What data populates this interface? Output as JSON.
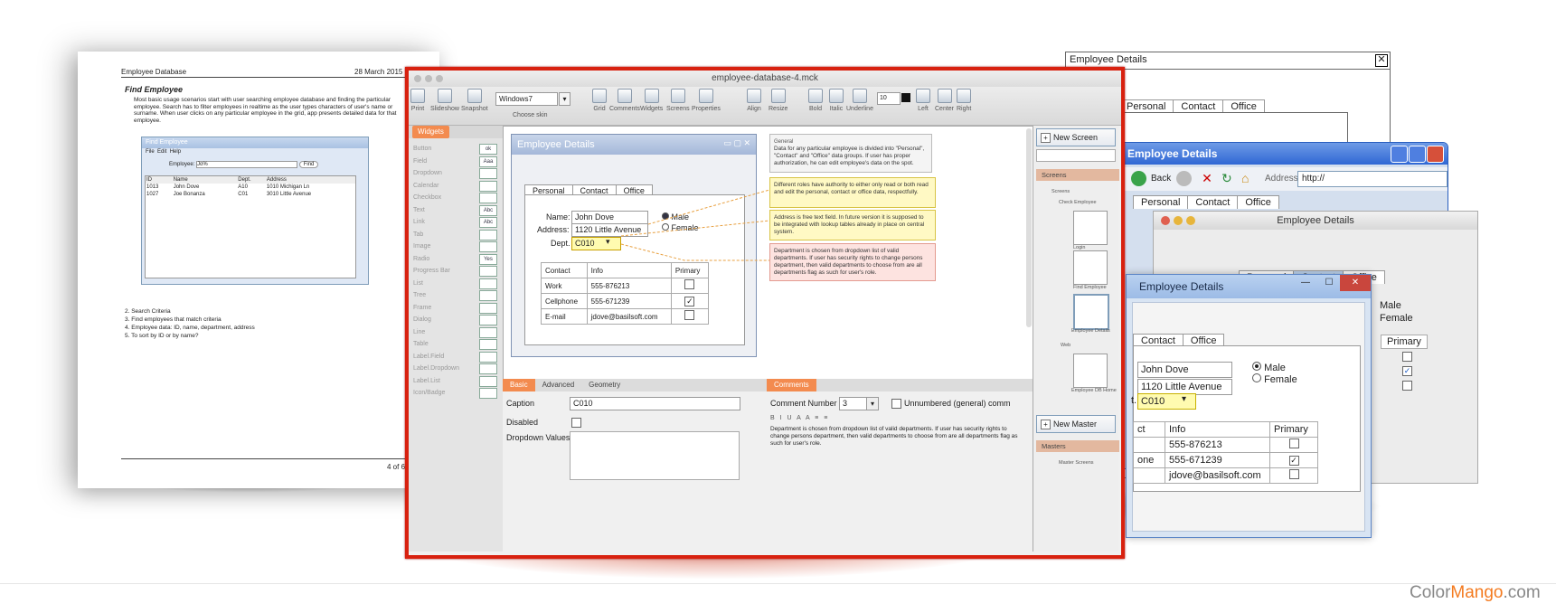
{
  "doc": {
    "header_left": "Employee Database",
    "header_right": "28 March 2015",
    "heading": "Find Employee",
    "para": "Most basic usage scenarios start with user searching employee database and finding the particular employee. Search has to filter employees in realtime as the user types characters of user's name or surname. When user clicks on any particular employee in the grid, app presents detailed data for that employee.",
    "mini_title": "Find Employee",
    "mini_menu": [
      "File",
      "Edit",
      "Help"
    ],
    "mini_label": "Employee:",
    "mini_value": "Jo%",
    "mini_find": "Find",
    "mini_cols": [
      "ID",
      "Name",
      "Dept.",
      "Address"
    ],
    "mini_rows": [
      [
        "1013",
        "John Dove",
        "A10",
        "1010 Michigan Ln"
      ],
      [
        "1027",
        "Joe Bonanza",
        "C01",
        "3010 Little Avenue"
      ]
    ],
    "list": [
      "2.  Search Criteria",
      "3.  Find employees that match criteria",
      "4.  Employee data: ID, name, department, address",
      "5.  To sort by ID or by name?"
    ],
    "footer": "4 of 6"
  },
  "plain": {
    "title": "Employee Details",
    "tabs": [
      "Personal",
      "Contact",
      "Office"
    ]
  },
  "xp": {
    "title": "Employee Details",
    "back": "Back",
    "address_label": "Address",
    "address": "http://",
    "tabs": [
      "Personal",
      "Contact",
      "Office"
    ]
  },
  "mac": {
    "title": "Employee Details",
    "tabs": [
      "Personal",
      "Contact",
      "Office"
    ],
    "male": "Male",
    "female": "Female",
    "primary": "Primary"
  },
  "w7": {
    "title": "Employee Details",
    "tabs": [
      "Contact",
      "Office"
    ],
    "name": "John Dove",
    "address": "1120 Little Avenue",
    "dept": "C010",
    "dept_label": "t.",
    "male": "Male",
    "female": "Female",
    "grid_head": [
      "ct",
      "Info",
      "Primary"
    ],
    "grid_rows": [
      [
        "",
        "555-876213",
        false
      ],
      [
        "one",
        "555-671239",
        true
      ],
      [
        "",
        "jdove@basilsoft.com",
        false
      ]
    ]
  },
  "main": {
    "window_title": "employee-database-4.mck",
    "skin_value": "Windows7",
    "skin_label": "Choose skin",
    "font_size": "10",
    "toolbar": [
      "Print",
      "Slideshow",
      "Snapshot",
      "Grid",
      "Comments",
      "Widgets",
      "Screens",
      "Properties",
      "Align",
      "Resize",
      "Bold",
      "Italic",
      "Underline",
      "Left",
      "Center",
      "Right"
    ],
    "library_tab": "Widgets",
    "library": [
      "Button",
      "Field",
      "Dropdown",
      "Calendar",
      "Checkbox",
      "Text",
      "Link",
      "Tab",
      "Image",
      "Radio",
      "Progress Bar",
      "List",
      "Tree",
      "Frame",
      "Dialog",
      "Line",
      "Table",
      "Label.Field",
      "Label.Dropdown",
      "Label.List",
      "Icon/Badge"
    ],
    "library_previews": [
      "ok",
      "Aaa",
      "",
      "",
      "",
      "Abc",
      "Abc",
      "",
      "",
      "Yes",
      "",
      "",
      "",
      "",
      "",
      "",
      "",
      "",
      "",
      "",
      ""
    ],
    "design": {
      "title": "Employee Details",
      "tabs": [
        "Personal",
        "Contact",
        "Office"
      ],
      "name_label": "Name:",
      "name": "John Dove",
      "address_label": "Address:",
      "address": "1120 Little Avenue",
      "dept_label": "Dept.",
      "dept": "C010",
      "male": "Male",
      "female": "Female",
      "grid_head": [
        "Contact",
        "Info",
        "Primary"
      ],
      "grid_rows": [
        [
          "Work",
          "555-876213",
          false
        ],
        [
          "Cellphone",
          "555-671239",
          true
        ],
        [
          "E-mail",
          "jdove@basilsoft.com",
          false
        ]
      ]
    },
    "notes": [
      {
        "title": "General",
        "text": "Data for any particular employee is divided into \"Personal\", \"Contact\" and \"Office\" data groups. If user has proper authorization, he can edit employee's data on the spot."
      },
      {
        "title": "",
        "text": "Different roles have authority to either only read or both read and edit the personal, contact or office data, respectfully."
      },
      {
        "title": "",
        "text": "Address is free text field. In future version it is supposed to be integrated with lookup tables already in place on central system."
      },
      {
        "title": "",
        "text": "Department is chosen from dropdown list of valid departments. If user has security rights to change persons department, then valid departments to choose from are all departments flag as such for user's role."
      }
    ],
    "props_tabs": [
      "Basic",
      "Advanced",
      "Geometry"
    ],
    "caption_label": "Caption",
    "caption_value": "C010",
    "disabled_label": "Disabled",
    "dropdown_label": "Dropdown Values",
    "comments_tab": "Comments",
    "comment_number_label": "Comment Number",
    "comment_number": "3",
    "unnumbered_label": "Unnumbered (general) comm",
    "comment_text": "Department is chosen from dropdown list of valid departments. If user has security rights to change persons department, then valid departments to choose from are all departments flag as such for user's role.",
    "new_screen": "New Screen",
    "screens_head": "Screens",
    "tree_root": "Screens",
    "tree_group": "Check Employee",
    "thumbs": [
      "Login",
      "Find Employee",
      "Employee Details"
    ],
    "tree_group2": "Web",
    "thumb_web": "Employee DB Home",
    "new_master": "New Master",
    "masters_head": "Masters",
    "master_item": "Master Screens"
  },
  "brand": {
    "a": "Color",
    "b": "Mango",
    "c": ".com"
  },
  "colors": {
    "frame": "#d8210f",
    "accent": "#f38b4f",
    "note_yellow": "#fff9c4",
    "note_red": "#fde3e0"
  }
}
